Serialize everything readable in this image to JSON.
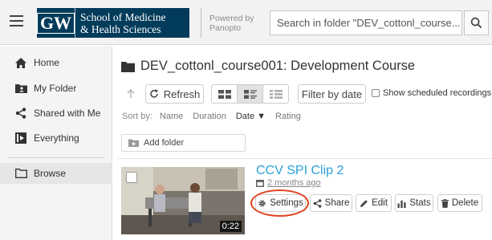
{
  "header": {
    "logo_initials": "GW",
    "logo_line1": "School of Medicine",
    "logo_line2": "& Health Sciences",
    "powered_line1": "Powered by",
    "powered_line2": "Panopto",
    "search_placeholder": "Search in folder \"DEV_cottonl_course..."
  },
  "sidebar": {
    "items": [
      {
        "label": "Home",
        "icon": "home-icon"
      },
      {
        "label": "My Folder",
        "icon": "folder-user-icon"
      },
      {
        "label": "Shared with Me",
        "icon": "share-icon"
      },
      {
        "label": "Everything",
        "icon": "media-icon"
      },
      {
        "label": "Browse",
        "icon": "folder-outline-icon"
      }
    ],
    "active": "Browse"
  },
  "main": {
    "folder_title": "DEV_cottonl_course001: Development Course",
    "toolbar": {
      "refresh_label": "Refresh",
      "filter_label": "Filter by date",
      "scheduled_label": "Show scheduled recordings",
      "view_selected": "list"
    },
    "sort": {
      "label": "Sort by:",
      "options": [
        "Name",
        "Duration",
        "Date ▼",
        "Rating"
      ],
      "active": "Date"
    },
    "add_folder_label": "Add folder",
    "sessions": [
      {
        "title": "CCV SPI Clip 2",
        "date": "2 months ago",
        "duration": "0:22",
        "actions": [
          "Settings",
          "Share",
          "Edit",
          "Stats",
          "Delete"
        ]
      }
    ]
  },
  "colors": {
    "brand_navy": "#033c5a",
    "link_blue": "#2b9fd8",
    "highlight_red": "#e0431e",
    "sidebar_bg": "#f4f4f4"
  }
}
